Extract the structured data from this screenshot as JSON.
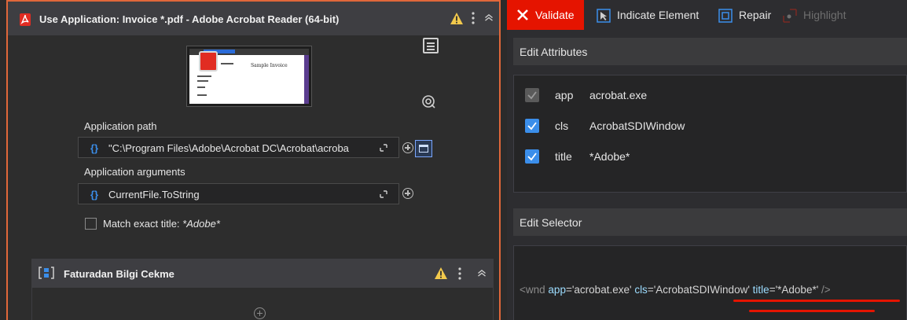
{
  "activity": {
    "title": "Use Application: Invoice *.pdf - Adobe Acrobat Reader (64-bit)",
    "icon": "pdf-icon",
    "thumbnail": {
      "sample_text": "Sample Invoice"
    },
    "app_path": {
      "label": "Application path",
      "value": "\"C:\\Program Files\\Adobe\\Acrobat DC\\Acrobat\\acroba"
    },
    "app_args": {
      "label": "Application arguments",
      "value": "CurrentFile.ToString"
    },
    "match_title": {
      "label": "Match exact title:",
      "value": "*Adobe*",
      "checked": false
    }
  },
  "child_activity": {
    "title": "Faturadan Bilgi Cekme"
  },
  "toolbar": {
    "validate": "Validate",
    "indicate": "Indicate Element",
    "repair": "Repair",
    "highlight": "Highlight"
  },
  "edit_attributes": {
    "title": "Edit Attributes",
    "rows": [
      {
        "name": "app",
        "value": "acrobat.exe",
        "checked": true,
        "disabled": true
      },
      {
        "name": "cls",
        "value": "AcrobatSDIWindow",
        "checked": true,
        "disabled": false
      },
      {
        "name": "title",
        "value": "*Adobe*",
        "checked": true,
        "disabled": false
      }
    ]
  },
  "edit_selector": {
    "title": "Edit Selector",
    "tag_open": "<wnd",
    "attr_app": "app",
    "val_app": "'acrobat.exe'",
    "attr_cls": "cls",
    "val_cls": "'AcrobatSDIWindow'",
    "attr_title": "title",
    "val_title": "'*Adobe*'",
    "tag_close": "/>"
  },
  "colors": {
    "accent_orange": "#e0673a",
    "validate_red": "#e51400",
    "checkbox_blue": "#3b8eea",
    "warning_yellow": "#f2c94c"
  }
}
